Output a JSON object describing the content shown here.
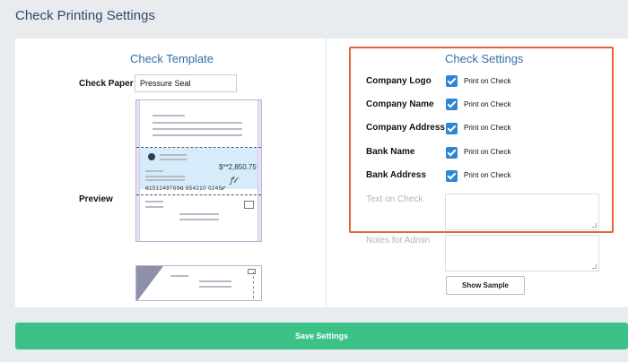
{
  "page": {
    "title": "Check Printing Settings"
  },
  "template": {
    "heading": "Check Template",
    "check_paper_label": "Check Paper",
    "check_paper_value": "Pressure Seal",
    "preview_label": "Preview",
    "preview_amount": "$**2,850.75",
    "preview_micr": "⑆151249769⑆ 854210 0245⑈",
    "preview_signature": "𝓈𝒾𝑔"
  },
  "settings": {
    "heading": "Check Settings",
    "options": [
      {
        "label": "Company Logo",
        "checkbox_label": "Print on Check",
        "checked": true
      },
      {
        "label": "Company Name",
        "checkbox_label": "Print on Check",
        "checked": true
      },
      {
        "label": "Company Address",
        "checkbox_label": "Print on Check",
        "checked": true
      },
      {
        "label": "Bank Name",
        "checkbox_label": "Print on Check",
        "checked": true
      },
      {
        "label": "Bank Address",
        "checkbox_label": "Print on Check",
        "checked": true
      }
    ],
    "text_on_check_label": "Text on Check",
    "notes_for_admin_label": "Notes for Admin",
    "show_sample_label": "Show Sample"
  },
  "actions": {
    "save_label": "Save Settings"
  },
  "colors": {
    "accent": "#2f86d6",
    "highlight_border": "#e8623a",
    "save": "#3cc189"
  }
}
